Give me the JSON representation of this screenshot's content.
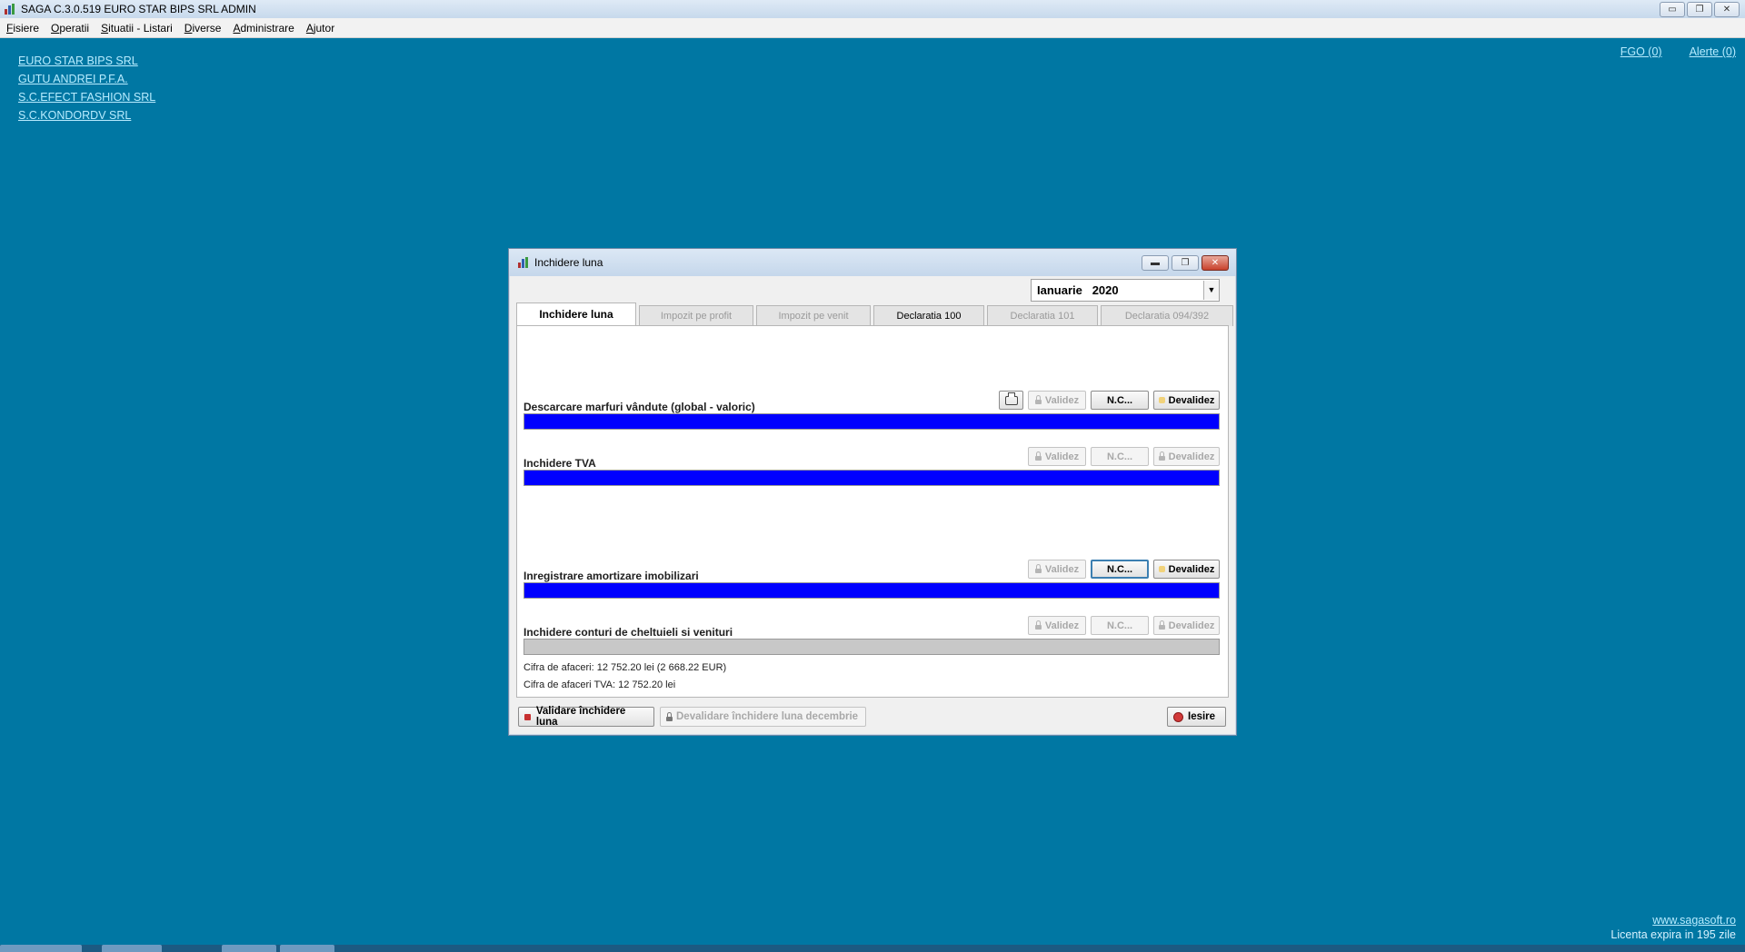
{
  "app": {
    "title": "SAGA C.3.0.519  EURO STAR BIPS SRL  ADMIN",
    "window_controls": [
      "▭",
      "❐",
      "✕"
    ]
  },
  "menu": [
    "Fisiere",
    "Operatii",
    "Situatii - Listari",
    "Diverse",
    "Administrare",
    "Ajutor"
  ],
  "companies": [
    "EURO STAR BIPS SRL",
    "GUTU ANDREI P.F.A.",
    "S.C.EFECT FASHION SRL",
    "S.C.KONDORDV SRL"
  ],
  "top_links": {
    "fgo": "FGO (0)",
    "alerte": "Alerte (0)"
  },
  "footer": {
    "website": "www.sagasoft.ro",
    "license": "Licenta expira in 195 zile"
  },
  "dialog": {
    "title": "Inchidere luna",
    "controls": [
      "▬",
      "❐",
      "✕"
    ],
    "period": {
      "month": "Ianuarie",
      "year": "2020",
      "arrow": "▼"
    },
    "tabs": [
      {
        "label": "Inchidere luna",
        "state": "active"
      },
      {
        "label": "Impozit pe profit",
        "state": "disabled"
      },
      {
        "label": "Impozit pe venit",
        "state": "disabled"
      },
      {
        "label": "Declaratia 100",
        "state": "enabled"
      },
      {
        "label": "Declaratia 101",
        "state": "disabled"
      },
      {
        "label": "Declaratia 094/392",
        "state": "disabled"
      }
    ],
    "sections": [
      {
        "label": "Descarcare marfuri vândute (global - valoric)",
        "valideaza": "Validez",
        "nc": "N.C...",
        "devalideaza": "Devalidez",
        "progress": 1.0
      },
      {
        "label": "Inchidere TVA",
        "valideaza": "Validez",
        "nc": "N.C...",
        "devalideaza": "Devalidez",
        "progress": 1.0
      },
      {
        "label": "Inregistrare amortizare imobilizari",
        "valideaza": "Validez",
        "nc": "N.C...",
        "devalideaza": "Devalidez",
        "progress": 1.0
      },
      {
        "label": "Inchidere conturi de cheltuieli si venituri",
        "valideaza": "Validez",
        "nc": "N.C...",
        "devalideaza": "Devalidez",
        "progress": 0.0
      }
    ],
    "info": {
      "cifra_afaceri": "Cifra de afaceri: 12 752.20 lei (2 668.22 EUR)",
      "cifra_afaceri_tva": "Cifra de afaceri TVA: 12 752.20 lei"
    },
    "buttons": {
      "validare": "Validare închidere luna",
      "devalidare": "Devalidare închidere luna decembrie",
      "iesire": "Iesire"
    }
  },
  "colors": {
    "desktop": "#0077a3",
    "progress_fill": "#0000ff",
    "link": "#b8ecff"
  }
}
